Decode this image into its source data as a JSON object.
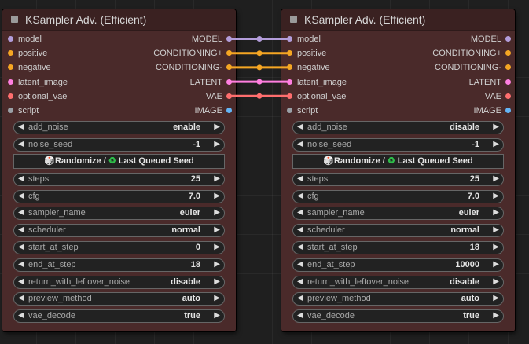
{
  "nodes": [
    {
      "title": "KSampler Adv. (Efficient)",
      "inputs": [
        "model",
        "positive",
        "negative",
        "latent_image",
        "optional_vae",
        "script"
      ],
      "outputs": [
        "MODEL",
        "CONDITIONING+",
        "CONDITIONING-",
        "LATENT",
        "VAE",
        "IMAGE"
      ],
      "widgets": {
        "add_noise": "enable",
        "noise_seed": "-1",
        "steps": "25",
        "cfg": "7.0",
        "sampler_name": "euler",
        "scheduler": "normal",
        "start_at_step": "0",
        "end_at_step": "18",
        "return_with_leftover_noise": "disable",
        "preview_method": "auto",
        "vae_decode": "true"
      }
    },
    {
      "title": "KSampler Adv. (Efficient)",
      "inputs": [
        "model",
        "positive",
        "negative",
        "latent_image",
        "optional_vae",
        "script"
      ],
      "outputs": [
        "MODEL",
        "CONDITIONING+",
        "CONDITIONING-",
        "LATENT",
        "VAE",
        "IMAGE"
      ],
      "widgets": {
        "add_noise": "disable",
        "noise_seed": "-1",
        "steps": "25",
        "cfg": "7.0",
        "sampler_name": "euler",
        "scheduler": "normal",
        "start_at_step": "18",
        "end_at_step": "10000",
        "return_with_leftover_noise": "disable",
        "preview_method": "auto",
        "vae_decode": "true"
      }
    }
  ],
  "widget_labels": {
    "add_noise": "add_noise",
    "noise_seed": "noise_seed",
    "steps": "steps",
    "cfg": "cfg",
    "sampler_name": "sampler_name",
    "scheduler": "scheduler",
    "start_at_step": "start_at_step",
    "end_at_step": "end_at_step",
    "return_with_leftover_noise": "return_with_leftover_noise",
    "preview_method": "preview_method",
    "vae_decode": "vae_decode"
  },
  "seed_button": {
    "left_text": "Randomize / ",
    "right_text": " Last Queued Seed",
    "dice_icon": "🎲",
    "recycle_icon": "♻"
  },
  "arrows": {
    "left": "◀",
    "right": "▶"
  },
  "slot_colors": {
    "model": "#b39ddb",
    "positive": "#f5a623",
    "negative": "#f5a623",
    "latent_image": "#ff7fe0",
    "optional_vae": "#ff6e6e",
    "script": "#9aa0a6",
    "MODEL": "#b39ddb",
    "CONDITIONING+": "#f5a623",
    "CONDITIONING-": "#f5a623",
    "LATENT": "#ff7fe0",
    "VAE": "#ff6e6e",
    "IMAGE": "#64b5f6"
  },
  "connections": [
    {
      "from": "MODEL",
      "to": "model",
      "color": "#b39ddb"
    },
    {
      "from": "CONDITIONING+",
      "to": "positive",
      "color": "#f5a623"
    },
    {
      "from": "CONDITIONING-",
      "to": "negative",
      "color": "#f5a623"
    },
    {
      "from": "LATENT",
      "to": "latent_image",
      "color": "#ff7fe0"
    },
    {
      "from": "VAE",
      "to": "optional_vae",
      "color": "#ff6e6e"
    }
  ]
}
